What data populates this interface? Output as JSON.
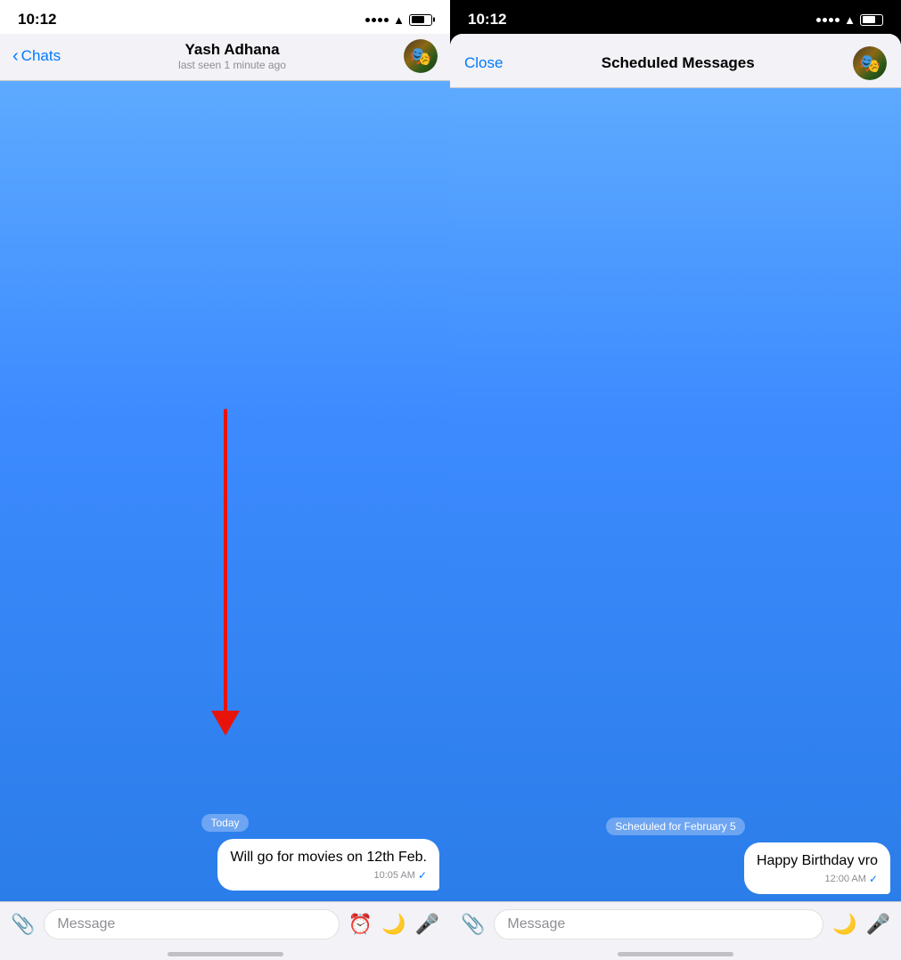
{
  "left_phone": {
    "status": {
      "time": "10:12"
    },
    "nav": {
      "back_label": "Chats",
      "title": "Yash Adhana",
      "subtitle": "last seen 1 minute ago"
    },
    "chat": {
      "date_badge": "Today",
      "message_text": "Will go for movies on 12th Feb.",
      "message_time": "10:05 AM",
      "message_check": "✓"
    },
    "input": {
      "placeholder": "Message"
    }
  },
  "right_phone": {
    "status": {
      "time": "10:12"
    },
    "modal": {
      "close_label": "Close",
      "title": "Scheduled Messages"
    },
    "chat": {
      "scheduled_badge": "Scheduled for February 5",
      "message_text": "Happy Birthday vro",
      "message_time": "12:00 AM",
      "message_check": "✓"
    },
    "input": {
      "placeholder": "Message"
    }
  }
}
